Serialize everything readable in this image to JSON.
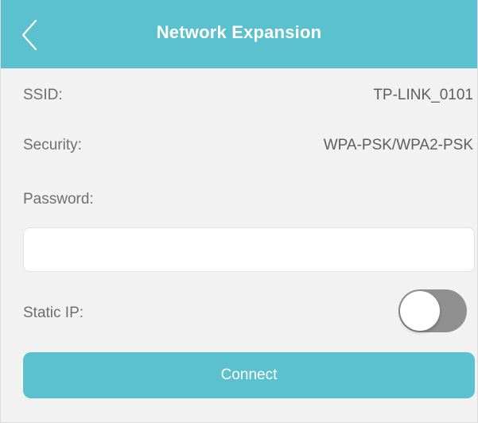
{
  "header": {
    "title": "Network Expansion",
    "back_icon": "chevron-left-icon"
  },
  "network": {
    "ssid_label": "SSID:",
    "ssid_value": "TP-LINK_0101",
    "security_label": "Security:",
    "security_value": "WPA-PSK/WPA2-PSK",
    "password_label": "Password:",
    "password_value": "",
    "static_ip_label": "Static IP:",
    "static_ip_enabled": false
  },
  "actions": {
    "connect_label": "Connect"
  },
  "colors": {
    "accent": "#5bc1cf",
    "toggle_off": "#909090",
    "background": "#f2f2f2"
  }
}
